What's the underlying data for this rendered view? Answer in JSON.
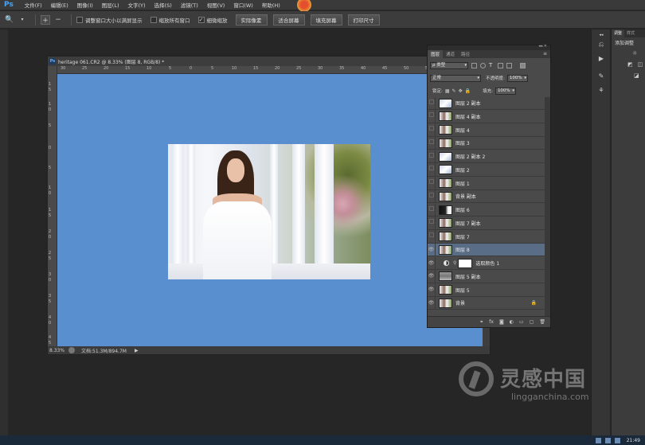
{
  "app": {
    "logo": "Ps",
    "menu": [
      "文件(F)",
      "编辑(E)",
      "图像(I)",
      "图层(L)",
      "文字(Y)",
      "选择(S)",
      "滤镜(T)",
      "视图(V)",
      "窗口(W)",
      "帮助(H)"
    ]
  },
  "options_bar": {
    "tool_icon": "zoom-icon",
    "checkbox_resize": "调整窗口大小以满屏显示",
    "checkbox_all_windows": "缩放所有窗口",
    "checkbox_scrubby": "细微缩放",
    "btn_actual": "实际像素",
    "btn_fit": "适合屏幕",
    "btn_fill": "填充屏幕",
    "btn_print": "打印尺寸"
  },
  "document": {
    "tab_title": "heritage 061.CR2 @ 8.33% (图层 8, RGB/8) *",
    "zoom": "8.33%",
    "doc_info": "文档:51.3M/894.7M",
    "ruler_top": [
      "30",
      "25",
      "20",
      "15",
      "10",
      "5",
      "0",
      "5",
      "10",
      "15",
      "20",
      "25",
      "30",
      "35",
      "40",
      "45",
      "50",
      "55",
      "60",
      "65"
    ],
    "ruler_left": [
      "1",
      "5",
      "1",
      "0",
      "5",
      "0",
      "5",
      "1",
      "0",
      "1",
      "5",
      "2",
      "0",
      "2",
      "5",
      "3",
      "0",
      "3",
      "5",
      "4",
      "0",
      "4",
      "5"
    ],
    "canvas_color": "#5a8fcf"
  },
  "layers_panel": {
    "tabs": [
      "图层",
      "通道",
      "路径"
    ],
    "filter_type": "类型",
    "blend_mode": "正常",
    "opacity_label": "不透明度:",
    "opacity_value": "100%",
    "lock_label": "锁定:",
    "fill_label": "填充:",
    "fill_value": "100%",
    "layers": [
      {
        "name": "图层 2 副本",
        "visible": false,
        "thumb": "pattern"
      },
      {
        "name": "图层 4 副本",
        "visible": false,
        "thumb": "photo"
      },
      {
        "name": "图层 4",
        "visible": false,
        "thumb": "photo"
      },
      {
        "name": "图层 3",
        "visible": false,
        "thumb": "photo"
      },
      {
        "name": "图层 2 副本 2",
        "visible": false,
        "thumb": "pattern"
      },
      {
        "name": "图层 2",
        "visible": false,
        "thumb": "pattern"
      },
      {
        "name": "图层 1",
        "visible": false,
        "thumb": "photo"
      },
      {
        "name": "背景 副本",
        "visible": false,
        "thumb": "photo"
      },
      {
        "name": "图层 6",
        "visible": false,
        "thumb": "dark"
      },
      {
        "name": "图层 7 副本",
        "visible": false,
        "thumb": "photo"
      },
      {
        "name": "图层 7",
        "visible": false,
        "thumb": "photo"
      },
      {
        "name": "图层 8",
        "visible": true,
        "thumb": "photo",
        "selected": true
      },
      {
        "name": "选取颜色 1",
        "visible": true,
        "thumb": "adjustment"
      },
      {
        "name": "图层 5 副本",
        "visible": true,
        "thumb": "gray"
      },
      {
        "name": "图层 5",
        "visible": true,
        "thumb": "photo"
      },
      {
        "name": "背景",
        "visible": true,
        "thumb": "photo",
        "locked": true
      }
    ]
  },
  "adjustments_panel": {
    "tabs": [
      "调整",
      "样式"
    ],
    "title": "添加调整"
  },
  "watermark": {
    "cn": "灵感中国",
    "en": "lingganchina.com"
  },
  "taskbar": {
    "time": "21:49"
  }
}
